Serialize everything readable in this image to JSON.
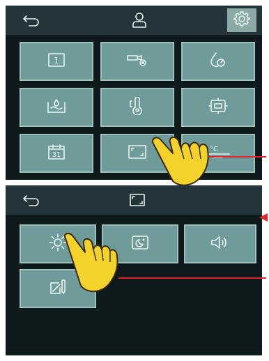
{
  "colors": {
    "screen_background": "#0f1a1c",
    "top_bar": "#23343a",
    "tile": "#6f9c9a",
    "tile_border": "#9fc0bc",
    "settings_active": "#8aa9a7",
    "pointer_hand": "#f4d22c",
    "callout_arrow": "#e0242c"
  },
  "main_screen": {
    "top_bar": {
      "back_icon": "back-arrow-icon",
      "user_icon": "user-icon",
      "settings_icon": "gear-icon",
      "settings_active": true
    },
    "tiles": [
      {
        "icon": "door-unit-icon",
        "label": "1"
      },
      {
        "icon": "camera-settings-icon"
      },
      {
        "icon": "water-drop-gauge-icon"
      },
      {
        "icon": "water-level-icon"
      },
      {
        "icon": "thermometer-icon"
      },
      {
        "icon": "display-frame-icon"
      },
      {
        "icon": "calendar-icon",
        "label": "31"
      },
      {
        "icon": "screen-frame-icon"
      },
      {
        "icon": "temperature-unit-icon",
        "label": "°C"
      }
    ]
  },
  "display_screen": {
    "top_bar": {
      "back_icon": "back-arrow-icon",
      "title_icon": "screen-frame-icon"
    },
    "tiles": [
      {
        "icon": "brightness-sun-icon"
      },
      {
        "icon": "night-mode-icon"
      },
      {
        "icon": "volume-icon"
      },
      {
        "icon": "edit-pencil-icon"
      }
    ]
  }
}
